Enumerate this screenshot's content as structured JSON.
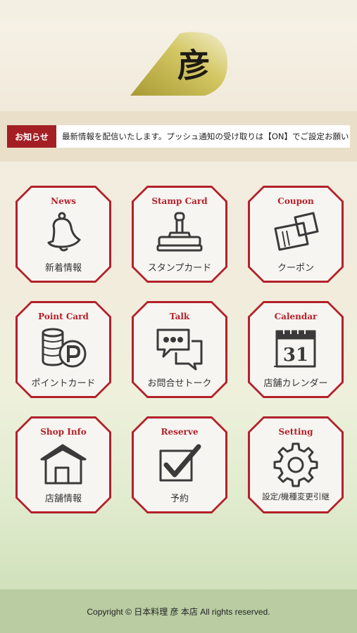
{
  "logo": {
    "glyph": "彦"
  },
  "notice": {
    "badge": "お知らせ",
    "text": "最新情報を配信いたします。プッシュ通知の受け取りは【ON】でご設定お願いします。"
  },
  "menu": [
    {
      "title": "News",
      "label": "新着情報",
      "icon": "bell-icon"
    },
    {
      "title": "Stamp Card",
      "label": "スタンプカード",
      "icon": "stamp-icon"
    },
    {
      "title": "Coupon",
      "label": "クーポン",
      "icon": "coupon-icon"
    },
    {
      "title": "Point Card",
      "label": "ポイントカード",
      "icon": "point-coins-icon"
    },
    {
      "title": "Talk",
      "label": "お問合せトーク",
      "icon": "chat-bubbles-icon"
    },
    {
      "title": "Calendar",
      "label": "店舗カレンダー",
      "icon": "calendar-icon",
      "calendar_day": "31"
    },
    {
      "title": "Shop Info",
      "label": "店舗情報",
      "icon": "house-icon"
    },
    {
      "title": "Reserve",
      "label": "予約",
      "icon": "checkbox-icon"
    },
    {
      "title": "Setting",
      "label": "設定/機種変更引継",
      "icon": "gear-icon"
    }
  ],
  "footer": {
    "copyright": "Copyright © 日本料理 彦 本店 All rights reserved."
  },
  "colors": {
    "accent": "#b3212a",
    "logo_gold": "#c2b24a",
    "footer_bg": "#b9cca2"
  }
}
